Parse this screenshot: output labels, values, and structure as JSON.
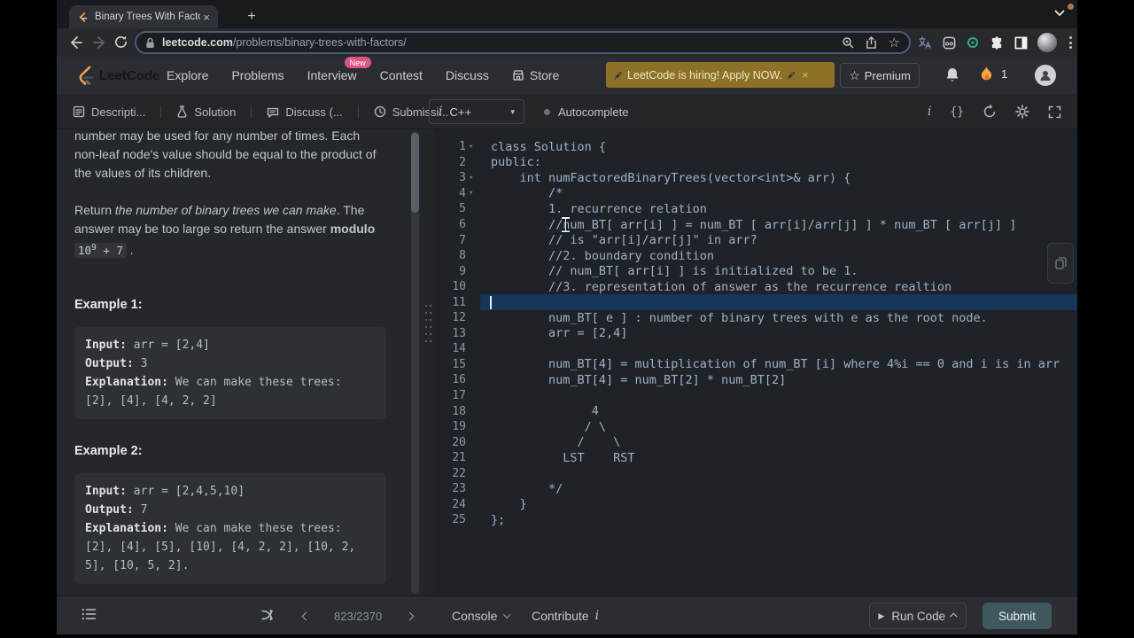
{
  "browser": {
    "tab_title": "Binary Trees With Factors - Lee",
    "close": "×",
    "new_tab": "+",
    "url": {
      "host": "leetcode.com",
      "path": "/problems/binary-trees-with-factors/"
    }
  },
  "header": {
    "logo": "LeetCode",
    "nav": [
      "Explore",
      "Problems",
      "Interview",
      "Contest",
      "Discuss",
      "Store"
    ],
    "new_badge": "New",
    "banner": {
      "text": "LeetCode is hiring! Apply NOW.",
      "close": "×"
    },
    "premium": {
      "star": "☆",
      "label": "Premium"
    },
    "streak_count": "1"
  },
  "toolrow": {
    "tabs": [
      "Descripti...",
      "Solution",
      "Discuss (...",
      "Submissi..."
    ],
    "language": "C++",
    "lang_info": "i",
    "autocomplete": "Autocomplete",
    "icon_braces": "{}",
    "icon_info": "i"
  },
  "description": {
    "p1": "number may be used for any number of times. Each non-leaf node's value should be equal to the product of the values of its children.",
    "p2_prefix": "Return ",
    "p2_italic": "the number of binary trees we can make",
    "p2_mid": ". The answer may be too large so return the answer ",
    "p2_bold": "modulo",
    "p2_code_base": "10",
    "p2_code_sup": "9",
    "p2_code_rest": " + 7",
    "p2_end": " .",
    "examples": [
      {
        "heading": "Example 1:",
        "input_label": "Input:",
        "input": " arr = [2,4]",
        "output_label": "Output:",
        "output": " 3",
        "expl_label": "Explanation:",
        "expl": " We can make these trees:",
        "trees": "[2], [4], [4, 2, 2]"
      },
      {
        "heading": "Example 2:",
        "input_label": "Input:",
        "input": " arr = [2,4,5,10]",
        "output_label": "Output:",
        "output": " 7",
        "expl_label": "Explanation:",
        "expl": " We can make these trees:",
        "trees": "[2], [4], [5], [10], [4, 2, 2], [10, 2, 5], [10, 5, 2]."
      }
    ]
  },
  "editor": {
    "current_line": 11,
    "lines": [
      {
        "n": 1,
        "fold": true,
        "t": "class Solution {"
      },
      {
        "n": 2,
        "t": "public:"
      },
      {
        "n": 3,
        "fold": true,
        "t": "    int numFactoredBinaryTrees(vector<int>& arr) {"
      },
      {
        "n": 4,
        "fold": true,
        "t": "        /*"
      },
      {
        "n": 5,
        "t": "        1. recurrence relation"
      },
      {
        "n": 6,
        "t": "        //num_BT[ arr[i] ] = num_BT [ arr[i]/arr[j] ] * num_BT [ arr[j] ]"
      },
      {
        "n": 7,
        "t": "        // is \"arr[i]/arr[j]\" in arr?"
      },
      {
        "n": 8,
        "t": "        //2. boundary condition"
      },
      {
        "n": 9,
        "t": "        // num_BT[ arr[i] ] is initialized to be 1."
      },
      {
        "n": 10,
        "t": "        //3. representation of answer as the recurrence realtion"
      },
      {
        "n": 11,
        "t": "        ",
        "cursor": true
      },
      {
        "n": 12,
        "t": "        num_BT[ e ] : number of binary trees with e as the root node."
      },
      {
        "n": 13,
        "t": "        arr = [2,4]"
      },
      {
        "n": 14,
        "t": ""
      },
      {
        "n": 15,
        "t": "        num_BT[4] = multiplication of num_BT [i] where 4%i == 0 and i is in arr"
      },
      {
        "n": 16,
        "t": "        num_BT[4] = num_BT[2] * num_BT[2]"
      },
      {
        "n": 17,
        "t": ""
      },
      {
        "n": 18,
        "t": "              4"
      },
      {
        "n": 19,
        "t": "             / \\"
      },
      {
        "n": 20,
        "t": "            /    \\"
      },
      {
        "n": 21,
        "t": "          LST    RST"
      },
      {
        "n": 22,
        "t": ""
      },
      {
        "n": 23,
        "t": "        */"
      },
      {
        "n": 24,
        "t": "    }"
      },
      {
        "n": 25,
        "t": "};"
      }
    ]
  },
  "bottombar": {
    "pagination": "823/2370",
    "console": "Console",
    "contribute": "Contribute",
    "contribute_i": "i",
    "run_code": "Run Code",
    "run_play": "▶",
    "submit": "Submit"
  }
}
